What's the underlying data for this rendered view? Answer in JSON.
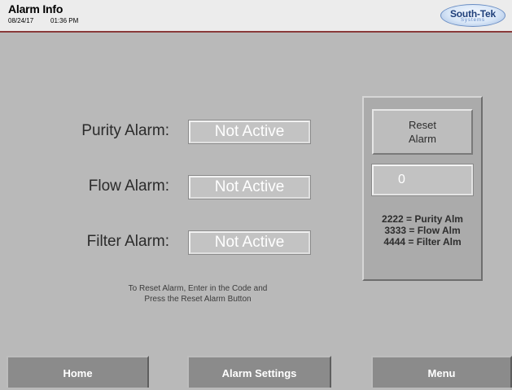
{
  "header": {
    "title": "Alarm Info",
    "date": "08/24/17",
    "time": "01:36 PM",
    "logo": {
      "main": "South-Tek",
      "sub": "Systems",
      "colors": {
        "primary": "#1f3f7a",
        "secondary": "#5f87c5"
      }
    }
  },
  "alarms": [
    {
      "label": "Purity Alarm:",
      "status": "Not Active"
    },
    {
      "label": "Flow Alarm:",
      "status": "Not Active"
    },
    {
      "label": "Filter Alarm:",
      "status": "Not Active"
    }
  ],
  "instructions": {
    "line1": "To Reset Alarm, Enter in the Code and",
    "line2": "Press the Reset Alarm Button"
  },
  "reset_panel": {
    "button_line1": "Reset",
    "button_line2": "Alarm",
    "code_value": "0",
    "codes": [
      "2222 = Purity Alm",
      "3333 = Flow Alm",
      "4444 = Filter Alm"
    ]
  },
  "nav": {
    "home": "Home",
    "alarm_settings": "Alarm Settings",
    "menu": "Menu"
  },
  "colors": {
    "background": "#b9b9b9",
    "header_border": "#8a3a3a",
    "nav_button": "#8b8b8b"
  }
}
